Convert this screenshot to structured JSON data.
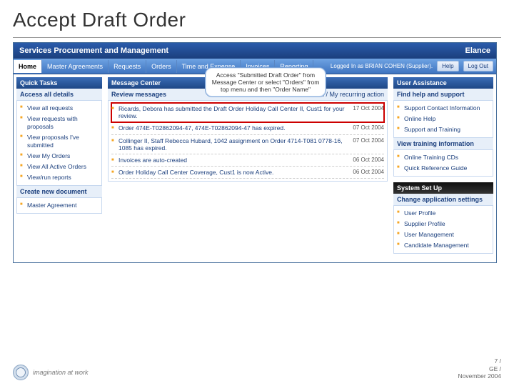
{
  "slide": {
    "title": "Accept Draft Order",
    "footer_tag": "imagination at work",
    "page": "7 /",
    "org": "GE /",
    "date": "November 2004"
  },
  "app": {
    "header_left": "Services Procurement and Management",
    "header_right": "Elance",
    "tabs": [
      "Home",
      "Master Agreements",
      "Requests",
      "Orders",
      "Time and Expense",
      "Invoices",
      "Reporting"
    ],
    "logged_in": "Logged In as BRIAN COHEN (Supplier).",
    "help_btn": "Help",
    "logout_btn": "Log Out"
  },
  "callout": "Access \"Submitted Draft Order\" from Message Center or select \"Orders\" from top menu and then \"Order Name\"",
  "quick_tasks": {
    "heading": "Quick Tasks",
    "sub1": "Access all details",
    "items1": [
      "View all requests",
      "View requests with proposals",
      "View proposals I've submitted",
      "View My Orders",
      "View All Active Orders",
      "View/run reports"
    ],
    "sub2": "Create new document",
    "items2": [
      "Master Agreement"
    ]
  },
  "message_center": {
    "heading": "Message Center",
    "sub": "Review messages",
    "link": "All / My recurring action",
    "rows": [
      {
        "text": "Ricards, Debora has submitted the Draft Order Holiday Call Center II, Cust1 for your review.",
        "date": "17 Oct 2004",
        "hl": true
      },
      {
        "text": "Order 474E-T02862094-47, 474E-T02862094-47 has expired.",
        "date": "07 Oct 2004",
        "hl": false
      },
      {
        "text": "Collinger II, Staff Rebecca Hubard, 1042 assignment on Order 4714-T081 0778-16, 1085 has expired.",
        "date": "07 Oct 2004",
        "hl": false
      },
      {
        "text": "Invoices are auto-created",
        "date": "06 Oct 2004",
        "hl": false
      },
      {
        "text": "Order Holiday Call Center Coverage, Cust1 is now Active.",
        "date": "06 Oct 2004",
        "hl": false
      }
    ]
  },
  "user_assist": {
    "heading": "User Assistance",
    "sub1": "Find help and support",
    "items1": [
      "Support Contact Information",
      "Online Help",
      "Support and Training"
    ],
    "sub2": "View training information",
    "items2": [
      "Online Training CDs",
      "Quick Reference Guide"
    ]
  },
  "system_setup": {
    "heading": "System Set Up",
    "sub": "Change application settings",
    "items": [
      "User Profile",
      "Supplier Profile",
      "User Management",
      "Candidate Management"
    ]
  }
}
